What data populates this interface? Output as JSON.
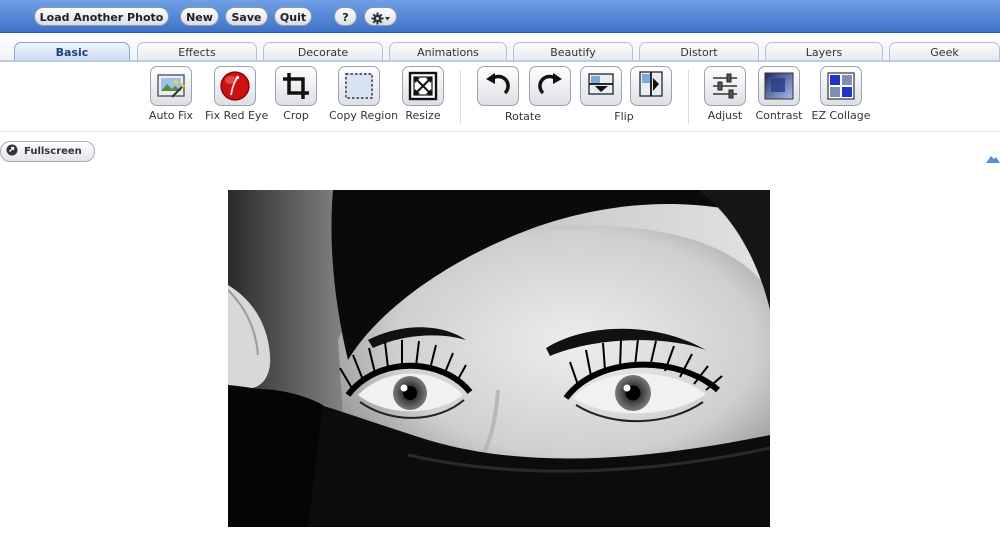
{
  "topbar": {
    "load_label": "Load Another Photo",
    "new_label": "New",
    "save_label": "Save",
    "quit_label": "Quit",
    "help_label": "?",
    "settings_icon": "gear-icon"
  },
  "tabs": [
    {
      "label": "Basic",
      "active": true
    },
    {
      "label": "Effects",
      "active": false
    },
    {
      "label": "Decorate",
      "active": false
    },
    {
      "label": "Animations",
      "active": false
    },
    {
      "label": "Beautify",
      "active": false
    },
    {
      "label": "Distort",
      "active": false
    },
    {
      "label": "Layers",
      "active": false
    },
    {
      "label": "Geek",
      "active": false
    }
  ],
  "tools": {
    "auto_fix": "Auto Fix",
    "fix_red_eye": "Fix Red Eye",
    "crop": "Crop",
    "copy_region": "Copy Region",
    "resize": "Resize",
    "rotate": "Rotate",
    "flip": "Flip",
    "adjust": "Adjust",
    "contrast": "Contrast",
    "ez_collage": "EZ Collage"
  },
  "fullscreen_label": "Fullscreen",
  "colors": {
    "topbar": "#3e72c8",
    "active_tab": "#c9daf3",
    "red_eye": "#cc1111",
    "collage_blue": "#2233cc"
  }
}
